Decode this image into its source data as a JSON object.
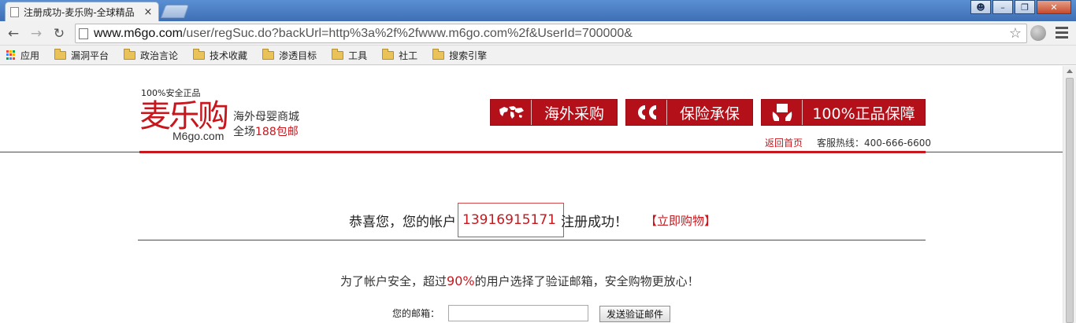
{
  "browser": {
    "tab_title": "注册成功-麦乐购-全球精品",
    "tab_close": "×",
    "window_buttons": {
      "minimize": "–",
      "restore": "❐",
      "close": "✕"
    },
    "url_host": "www.m6go.com",
    "url_path": "/user/regSuc.do?backUrl=http%3a%2f%2fwww.m6go.com%2f&UserId=700000&",
    "nav": {
      "back": "←",
      "forward": "→",
      "reload": "↻",
      "star": "☆"
    },
    "bookmarks": [
      {
        "label": "应用",
        "icon": "apps-grid-icon"
      },
      {
        "label": "漏洞平台",
        "icon": "folder-icon"
      },
      {
        "label": "政治言论",
        "icon": "folder-icon"
      },
      {
        "label": "技术收藏",
        "icon": "folder-icon"
      },
      {
        "label": "渗透目标",
        "icon": "folder-icon"
      },
      {
        "label": "工具",
        "icon": "folder-icon"
      },
      {
        "label": "社工",
        "icon": "folder-icon"
      },
      {
        "label": "搜索引擎",
        "icon": "folder-icon"
      }
    ]
  },
  "header": {
    "tagline": "100%安全正品",
    "logo_text": "麦乐购",
    "logo_domain": "M6go.com",
    "slogan_line1": "海外母婴商城",
    "slogan_line2_prefix": "全场",
    "slogan_line2_highlight": "188包邮",
    "badges": [
      {
        "label": "海外采购",
        "icon": "world-map-icon"
      },
      {
        "label": "保险承保",
        "icon": "insurance-icon"
      },
      {
        "label": "100%正品保障",
        "icon": "genuine-guarantee-icon"
      }
    ],
    "home_link": "返回首页",
    "hotline": "客服热线：400-666-6600"
  },
  "main": {
    "success_prefix": "恭喜您，您的帐户",
    "account": "13916915171",
    "success_suffix": "注册成功！",
    "shop_link": "【立即购物】",
    "secure_prefix": "为了帐户安全，超过",
    "secure_percent": "90%",
    "secure_suffix": "的用户选择了验证邮箱，安全购物更放心！",
    "email_label": "您的邮箱：",
    "email_value": "",
    "send_button": "发送验证邮件"
  },
  "colors": {
    "brand_red": "#c8161d",
    "badge_red": "#b3101a"
  }
}
